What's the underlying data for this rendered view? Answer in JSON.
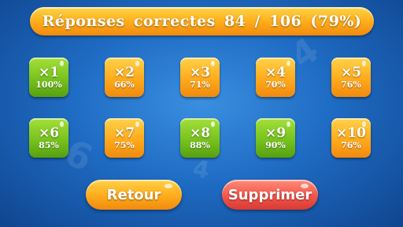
{
  "score": {
    "label": "Réponses correctes",
    "correct": "84",
    "separator": "/",
    "total": "106",
    "percent": "(79%)"
  },
  "tables": [
    {
      "label": "×1",
      "percent": "100%",
      "color": "green"
    },
    {
      "label": "×2",
      "percent": "66%",
      "color": "orange"
    },
    {
      "label": "×3",
      "percent": "71%",
      "color": "orange"
    },
    {
      "label": "×4",
      "percent": "70%",
      "color": "orange"
    },
    {
      "label": "×5",
      "percent": "76%",
      "color": "orange"
    },
    {
      "label": "×6",
      "percent": "85%",
      "color": "green"
    },
    {
      "label": "×7",
      "percent": "75%",
      "color": "orange"
    },
    {
      "label": "×8",
      "percent": "88%",
      "color": "green"
    },
    {
      "label": "×9",
      "percent": "90%",
      "color": "green"
    },
    {
      "label": "×10",
      "percent": "76%",
      "color": "orange"
    }
  ],
  "buttons": {
    "back_label": "Retour",
    "delete_label": "Supprimer"
  },
  "colors": {
    "background": "#1f6cc4",
    "good": "#78c21e",
    "average": "#ffaa1c",
    "delete": "#f2564a"
  }
}
